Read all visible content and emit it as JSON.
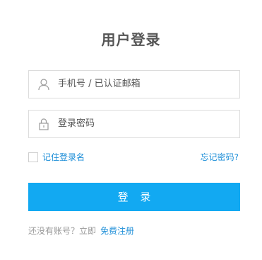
{
  "form": {
    "title": "用户登录",
    "username_placeholder": "手机号 / 已认证邮箱",
    "password_placeholder": "登录密码",
    "remember_label": "记住登录名",
    "forgot_label": "忘记密码?",
    "login_button": "登 录",
    "register_prompt": "还没有账号？立即",
    "register_link": "免费注册"
  },
  "icons": {
    "user": "user-icon",
    "lock": "lock-icon"
  },
  "colors": {
    "accent": "#12a9f2",
    "link": "#1f8fd8",
    "title": "#555555",
    "border": "#dcdcdc"
  }
}
